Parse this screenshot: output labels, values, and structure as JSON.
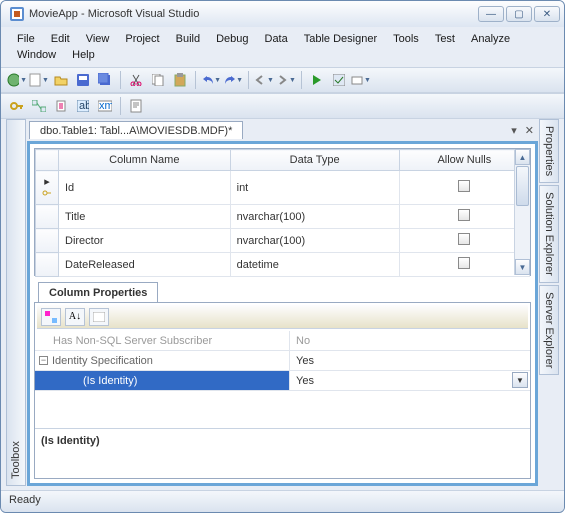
{
  "window": {
    "title": "MovieApp - Microsoft Visual Studio"
  },
  "menu": [
    "File",
    "Edit",
    "View",
    "Project",
    "Build",
    "Debug",
    "Data",
    "Table Designer",
    "Tools",
    "Test",
    "Analyze",
    "Window",
    "Help"
  ],
  "sidepanels": {
    "left": "Toolbox",
    "right": [
      "Properties",
      "Solution Explorer",
      "Server Explorer"
    ]
  },
  "document": {
    "tab": "dbo.Table1: Tabl...A\\MOVIESDB.MDF)*"
  },
  "designer": {
    "headers": [
      "Column Name",
      "Data Type",
      "Allow Nulls"
    ],
    "rows": [
      {
        "name": "Id",
        "type": "int",
        "allow_nulls": false,
        "primary_key": true
      },
      {
        "name": "Title",
        "type": "nvarchar(100)",
        "allow_nulls": false
      },
      {
        "name": "Director",
        "type": "nvarchar(100)",
        "allow_nulls": false
      },
      {
        "name": "DateReleased",
        "type": "datetime",
        "allow_nulls": false
      }
    ]
  },
  "properties": {
    "tab": "Column Properties",
    "rows": [
      {
        "name": "Has Non-SQL Server Subscriber",
        "value": "No"
      },
      {
        "name": "Identity Specification",
        "value": "Yes"
      },
      {
        "name": "(Is Identity)",
        "value": "Yes",
        "selected": true
      }
    ],
    "description_title": "(Is Identity)"
  },
  "status": {
    "text": "Ready"
  }
}
